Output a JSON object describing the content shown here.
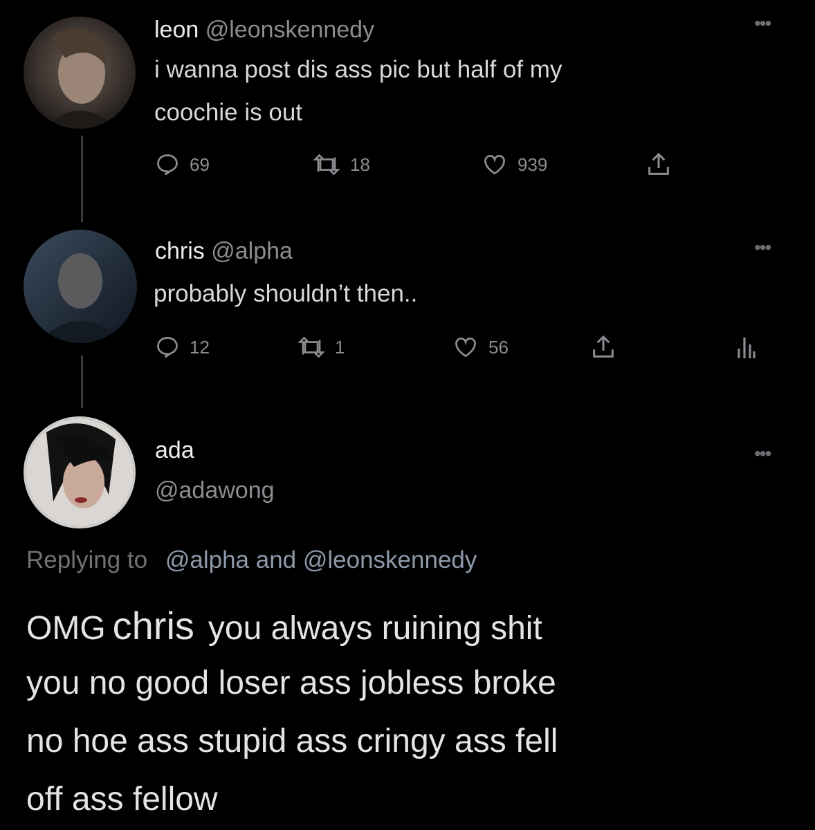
{
  "tweets": [
    {
      "name": "leon",
      "handle": "@leonskennedy",
      "text_lines": [
        "i wanna post dis ass pic but half of my",
        "coochie is out"
      ],
      "replies": "69",
      "retweets": "18",
      "likes": "939"
    },
    {
      "name": "chris",
      "handle": "@alpha",
      "text_lines": [
        "probably shouldn’t then.."
      ],
      "replies": "12",
      "retweets": "1",
      "likes": "56"
    }
  ],
  "reply_tweet": {
    "name": "ada",
    "handle": "@adawong",
    "replying_prefix": "Replying to",
    "replying_mentions": "@alpha and @leonskennedy",
    "line1_a": "OMG",
    "line1_b": "chris",
    "line1_c": "you always ruining shit",
    "line2": "you no good loser ass jobless broke",
    "line3": "no hoe ass stupid ass cringy ass fell",
    "line4": "off ass fellow"
  },
  "icons": [
    "reply-icon",
    "retweet-icon",
    "like-icon",
    "share-icon",
    "analytics-icon",
    "more-icon"
  ],
  "colors": {
    "background": "#000000",
    "secondary_text": "#8a8d91",
    "mention": "#8e9aaa"
  }
}
